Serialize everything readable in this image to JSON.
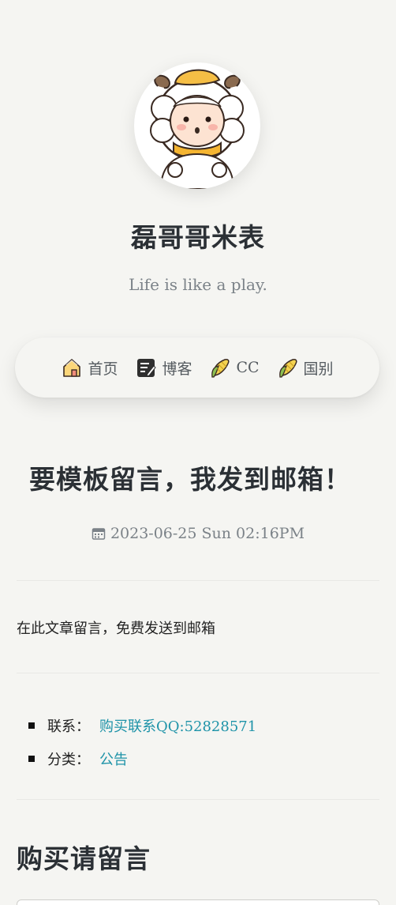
{
  "header": {
    "avatar_icon": "sheep-avatar-icon",
    "site_title": "磊哥哥米表",
    "site_subtitle": "Life is like a play."
  },
  "nav": {
    "items": [
      {
        "label": "首页",
        "icon": "house-icon"
      },
      {
        "label": "博客",
        "icon": "notepad-icon"
      },
      {
        "label": "CC",
        "icon": "corn-icon"
      },
      {
        "label": "国别",
        "icon": "corn-icon"
      }
    ]
  },
  "post": {
    "title": "要模板留言，我发到邮箱！",
    "date": "2023-06-25 Sun 02:16PM",
    "body": "在此文章留言，免费发送到邮箱"
  },
  "meta": {
    "contact_key": "联系：",
    "contact_value": "购买联系QQ:52828571",
    "category_key": "分类：",
    "category_value": "公告"
  },
  "comments": {
    "heading": "购买请留言"
  },
  "colors": {
    "background": "#f5f5f2",
    "link": "#1e93a8",
    "heading": "#2b3035",
    "muted": "#7b8288"
  }
}
